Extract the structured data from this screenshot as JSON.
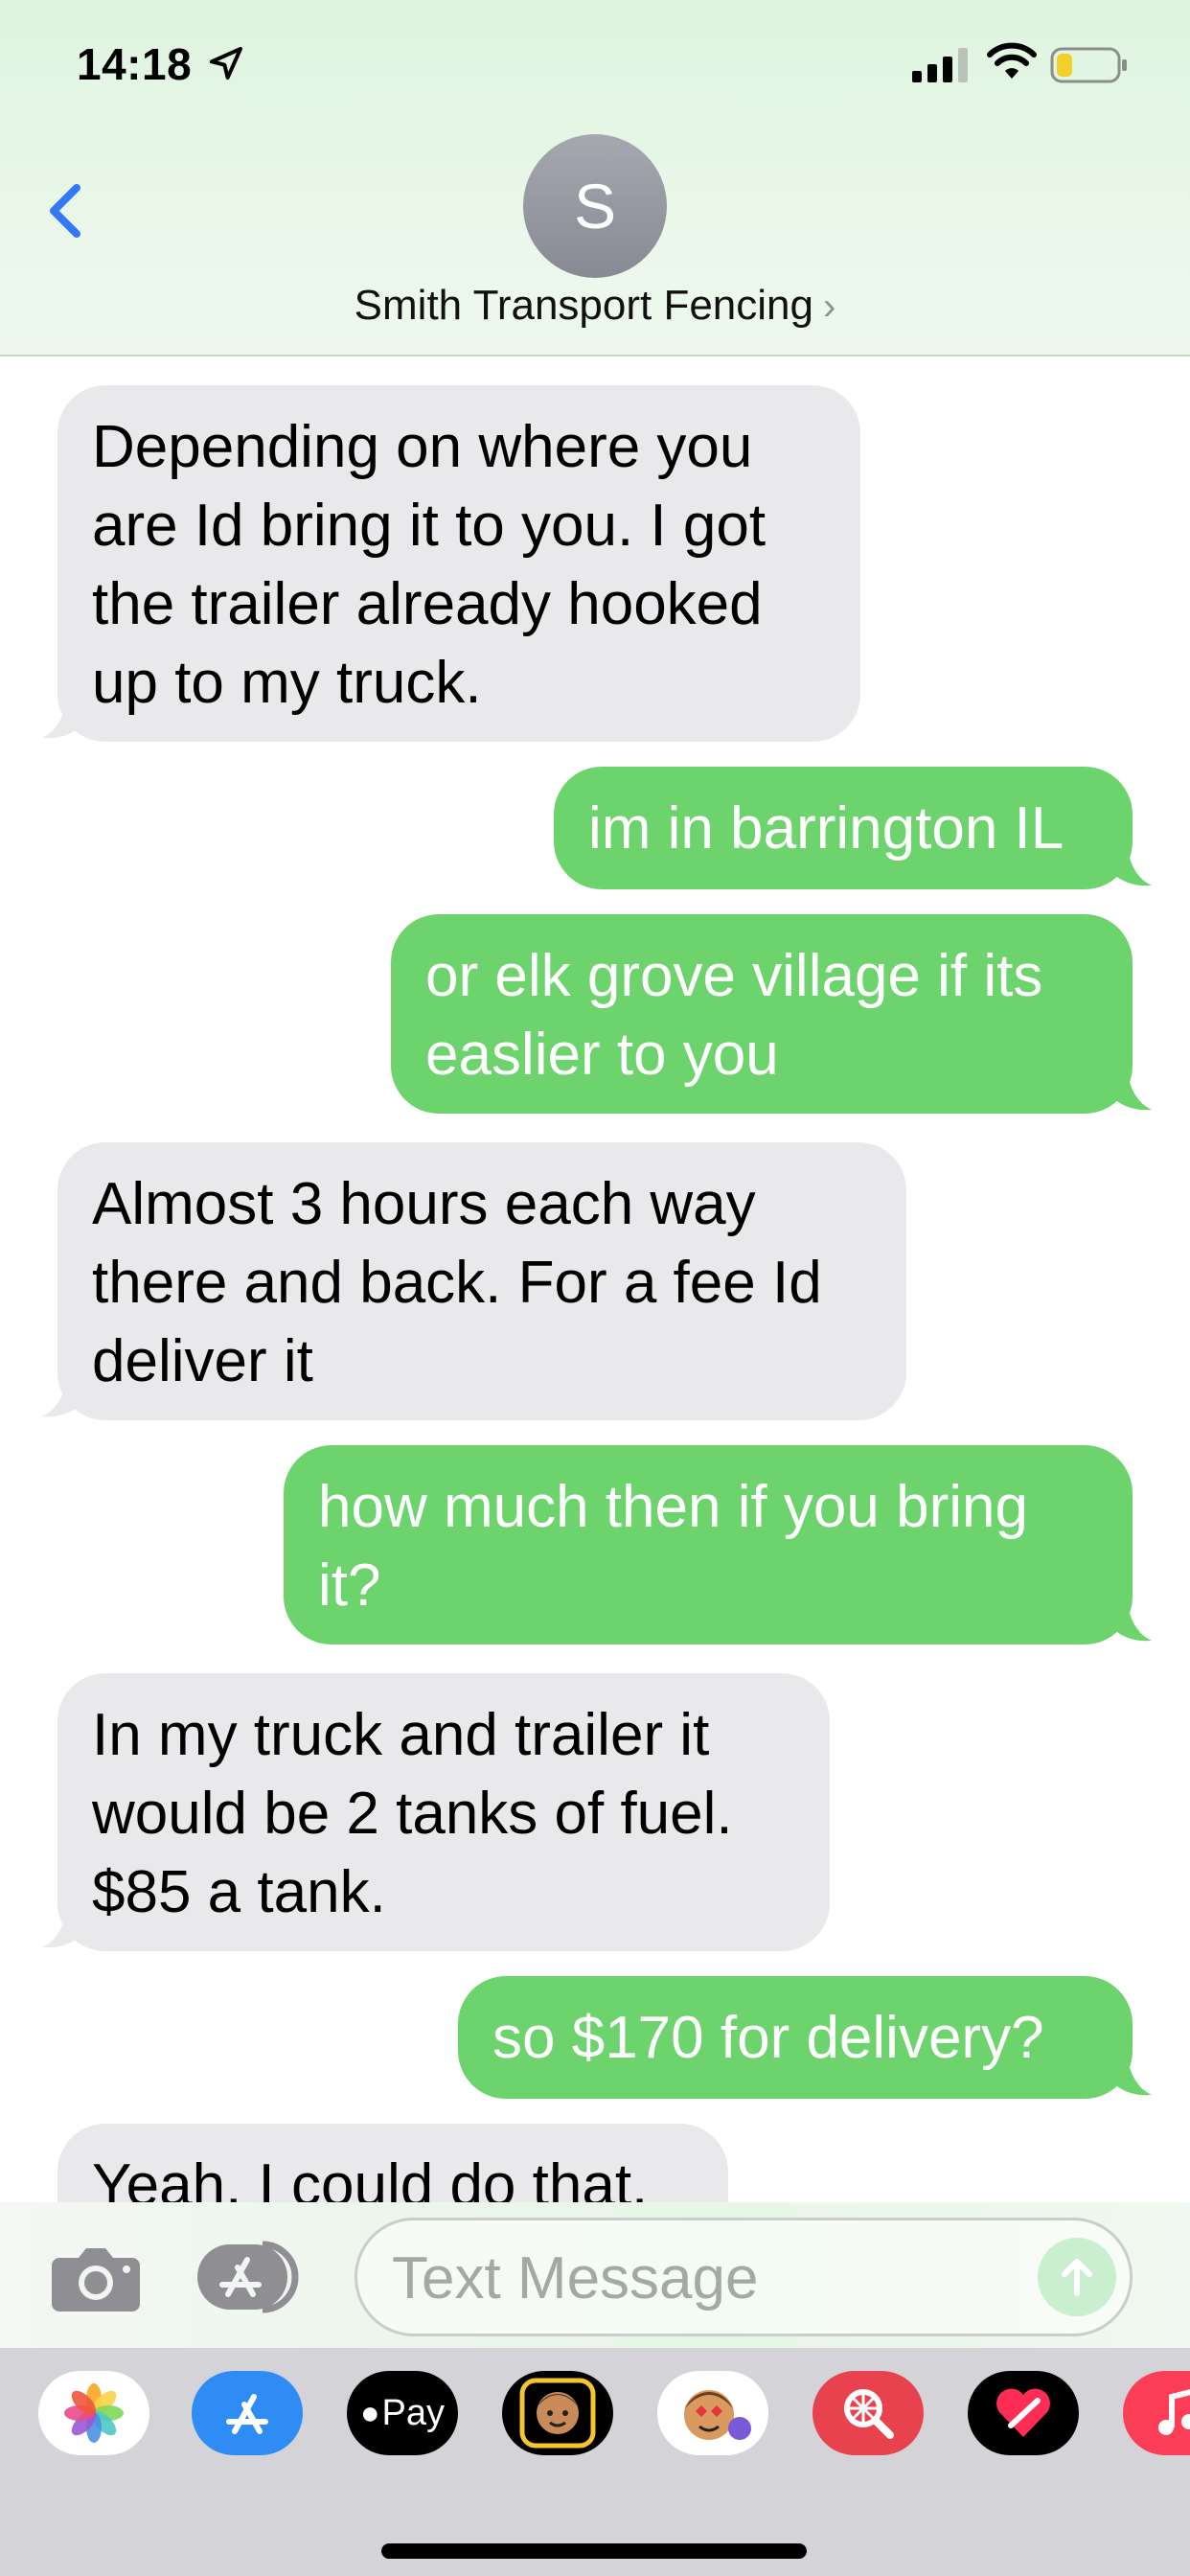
{
  "status_bar": {
    "time": "14:18"
  },
  "header": {
    "avatar_letter": "S",
    "contact_name": "Smith Transport Fencing"
  },
  "messages": [
    {
      "direction": "incoming",
      "lines": [
        "Depending on where you",
        "are Id bring it to you. I got",
        "the trailer already hooked",
        "up to my truck."
      ]
    },
    {
      "direction": "outgoing",
      "lines": [
        "im in barrington IL"
      ]
    },
    {
      "direction": "outgoing",
      "lines": [
        "or elk grove village if its",
        "easlier to you"
      ]
    },
    {
      "direction": "incoming",
      "lines": [
        "Almost 3 hours each way",
        "there and back. For a fee Id",
        "deliver it"
      ]
    },
    {
      "direction": "outgoing",
      "lines": [
        "how much then if you bring",
        "it?"
      ]
    },
    {
      "direction": "incoming",
      "lines": [
        "In my truck and trailer it",
        "would be 2 tanks of fuel.",
        "$85 a tank."
      ]
    },
    {
      "direction": "outgoing",
      "lines": [
        "so $170 for delivery?"
      ]
    },
    {
      "direction": "incoming",
      "lines": [
        "Yeah. I could do that."
      ]
    }
  ],
  "input_bar": {
    "placeholder": "Text Message"
  },
  "app_drawer": {
    "apple_pay_label": "Pay"
  },
  "colors": {
    "incoming_bubble": "#e9e9eb",
    "outgoing_bubble": "#6dd36d",
    "link_blue": "#3478f6"
  },
  "icons": [
    "location-arrow-icon",
    "signal-icon",
    "wifi-icon",
    "battery-icon",
    "back-chevron-icon",
    "camera-icon",
    "app-store-icon",
    "send-arrow-icon",
    "photos-icon",
    "memoji-icon",
    "stickers-icon",
    "image-search-icon",
    "digital-touch-icon",
    "music-icon"
  ]
}
